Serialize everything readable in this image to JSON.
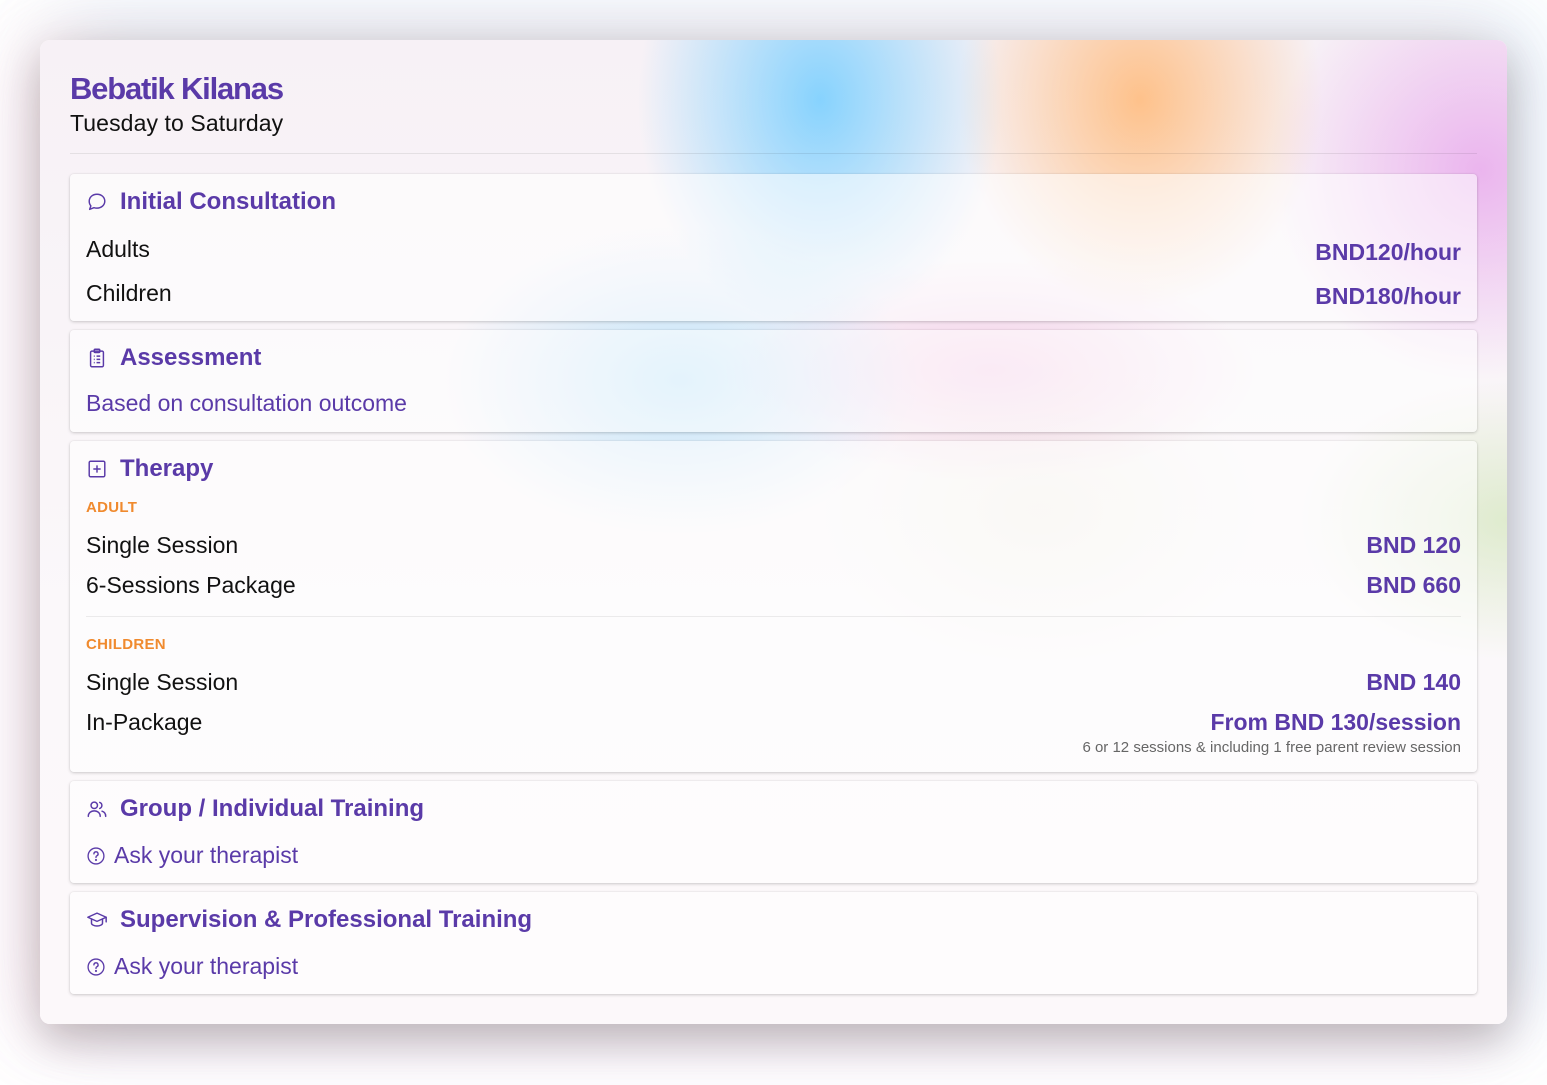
{
  "clinic": {
    "name": "Bebatik Kilanas",
    "schedule": "Tuesday to Saturday"
  },
  "sections": {
    "consultation": {
      "icon": "chat-bubble-icon",
      "title": "Initial Consultation",
      "rows": [
        {
          "label": "Adults",
          "price": "BND120/hour"
        },
        {
          "label": "Children",
          "price": "BND180/hour"
        }
      ]
    },
    "assessment": {
      "icon": "clipboard-icon",
      "title": "Assessment",
      "text": "Based on consultation outcome"
    },
    "therapy": {
      "icon": "plus-square-icon",
      "title": "Therapy",
      "adult": {
        "category": "ADULT",
        "rows": [
          {
            "label": "Single Session",
            "price": "BND 120"
          },
          {
            "label": "6-Sessions Package",
            "price": "BND 660"
          }
        ]
      },
      "children": {
        "category": "CHILDREN",
        "rows": [
          {
            "label": "Single Session",
            "price": "BND 140"
          },
          {
            "label": "In-Package",
            "price": "From BND 130/session"
          }
        ],
        "note": "6 or 12 sessions & including 1 free parent review session"
      }
    },
    "group": {
      "icon": "users-icon",
      "title": "Group / Individual Training",
      "text": "Ask your therapist"
    },
    "supervision": {
      "icon": "graduation-cap-icon",
      "title": "Supervision & Professional Training",
      "text": "Ask your therapist"
    }
  },
  "colors": {
    "accent": "#5a3aa8",
    "category": "#f08a2e",
    "text": "#111111"
  }
}
